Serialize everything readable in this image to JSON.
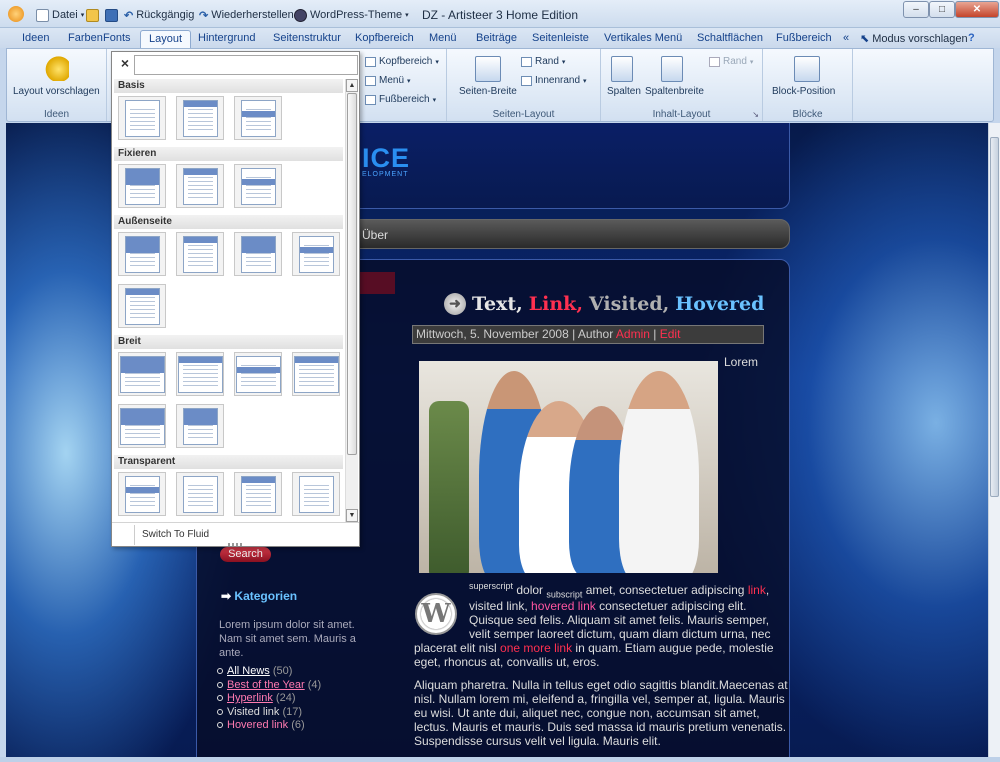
{
  "titlebar": {
    "title": "DZ - Artisteer 3 Home Edition",
    "quick_access": {
      "file": "Datei",
      "undo": "Rückgängig",
      "redo": "Wiederherstellen",
      "theme": "WordPress-Theme"
    },
    "window_buttons": {
      "minimize": "–",
      "maximize": "□",
      "close": "✕"
    }
  },
  "tabs": {
    "items": [
      "Ideen",
      "Farben",
      "Fonts",
      "Layout",
      "Hintergrund",
      "Seitenstruktur",
      "Kopfbereich",
      "Menü",
      "Beiträge",
      "Seitenleiste",
      "Vertikales Menü",
      "Schaltflächen",
      "Fußbereich"
    ],
    "active": "Layout",
    "collapse": "«",
    "suggest_mode": "Modus vorschlagen",
    "help": "?"
  },
  "ribbon": {
    "ideen": {
      "button": "Layout vorschlagen",
      "group": "Ideen"
    },
    "header_items": {
      "kopfbereich": "Kopfbereich",
      "menu": "Menü",
      "fussbereich": "Fußbereich"
    },
    "seiten_layout": {
      "breite": "Seiten-Breite",
      "rand": "Rand",
      "innenrand": "Innenrand",
      "group": "Seiten-Layout"
    },
    "inhalt_layout": {
      "spalten": "Spalten",
      "spaltenbreite": "Spaltenbreite",
      "rand": "Rand",
      "group": "Inhalt-Layout"
    },
    "bloecke": {
      "button": "Block-Position",
      "group": "Blöcke"
    }
  },
  "dropdown": {
    "close": "×",
    "search_value": "",
    "categories": [
      "Basis",
      "Fixieren",
      "Außenseite",
      "Breit",
      "Transparent"
    ],
    "footer": "Switch To Fluid"
  },
  "site": {
    "logo_text": "ICE",
    "logo_sub": "ELOPMENT",
    "nav_about": "Über",
    "post": {
      "title_text": "Text,",
      "title_link": "Link,",
      "title_visited": "Visited,",
      "title_hovered": "Hovered",
      "meta_date": "Mittwoch, 5. November 2008 | Author",
      "meta_author": "Admin",
      "meta_sep": "|",
      "meta_edit": "Edit",
      "lorem_side": "Lorem",
      "p1_sup": "superscript",
      "p1_a": " dolor ",
      "p1_sub": "subscript",
      "p1_b": " amet, consectetuer adipiscing ",
      "p1_link": "link",
      "p1_c": ",",
      "p1_line2a": "visited link, ",
      "p1_hovered": "hovered link",
      "p1_line2b": " consectetuer adipiscing elit.",
      "p1_line3": "Quisque sed felis. Aliquam sit amet felis. Mauris semper,",
      "p1_line4": "velit semper laoreet dictum, quam diam dictum urna, nec",
      "p1_line5a": "placerat elit nisl ",
      "p1_more": "one more link",
      "p1_line5b": " in quam. Etiam augue pede, molestie",
      "p1_line6": "eget, rhoncus at, convallis ut, eros.",
      "p2_line1": "Aliquam pharetra. Nulla in tellus eget odio sagittis blandit.Maecenas at",
      "p2_line2": "nisl. Nullam lorem mi, eleifend a, fringilla vel, semper at, ligula. Mauris",
      "p2_line3": "eu wisi. Ut ante dui, aliquet nec, congue non, accumsan sit amet,",
      "p2_line4": "lectus. Mauris et mauris. Duis sed massa id mauris pretium venenatis.",
      "p2_line5": "Suspendisse cursus velit vel ligula. Mauris elit."
    },
    "sidebar": {
      "search_button": "Search",
      "categories_title": "Kategorien",
      "categories_desc": "Lorem ipsum dolor sit amet. Nam sit amet sem. Mauris a ante.",
      "items": [
        {
          "label": "All News",
          "count": "(50)"
        },
        {
          "label": "Best of the Year",
          "count": "(4)"
        },
        {
          "label": "Hyperlink",
          "count": "(24)"
        },
        {
          "label": "Visited link",
          "count": "(17)"
        },
        {
          "label": "Hovered link",
          "count": "(6)"
        }
      ]
    }
  },
  "colors": {
    "link": "#ff3050",
    "visited": "#b0b0b0",
    "hovered": "#6ac2ff",
    "ribbon_text": "#15428b"
  }
}
